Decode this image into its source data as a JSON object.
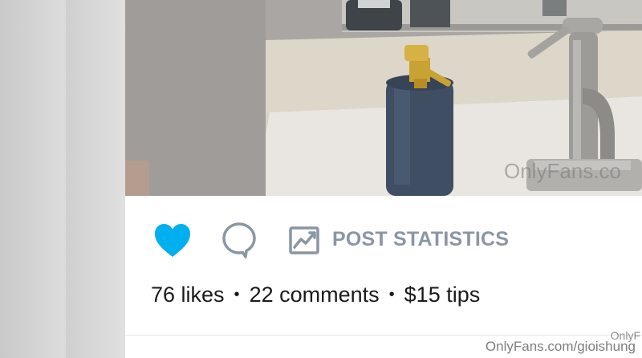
{
  "post": {
    "photo": {
      "alt": "bathroom sink with soap dispenser",
      "watermark_text": "OnlyFans.co"
    },
    "actions": {
      "like_icon": "heart-icon",
      "comment_icon": "comment-bubble-icon",
      "stats_icon": "chart-icon",
      "stats_label": "POST STATISTICS",
      "like_color": "#00aff0",
      "muted_color": "#8a96a3"
    },
    "summary": {
      "likes": "76 likes",
      "comments": "22 comments",
      "tips": "$15 tips",
      "separator": "•"
    }
  },
  "watermark": {
    "top": "OnlyF",
    "bottom": "OnlyFans.com/gioishung"
  }
}
